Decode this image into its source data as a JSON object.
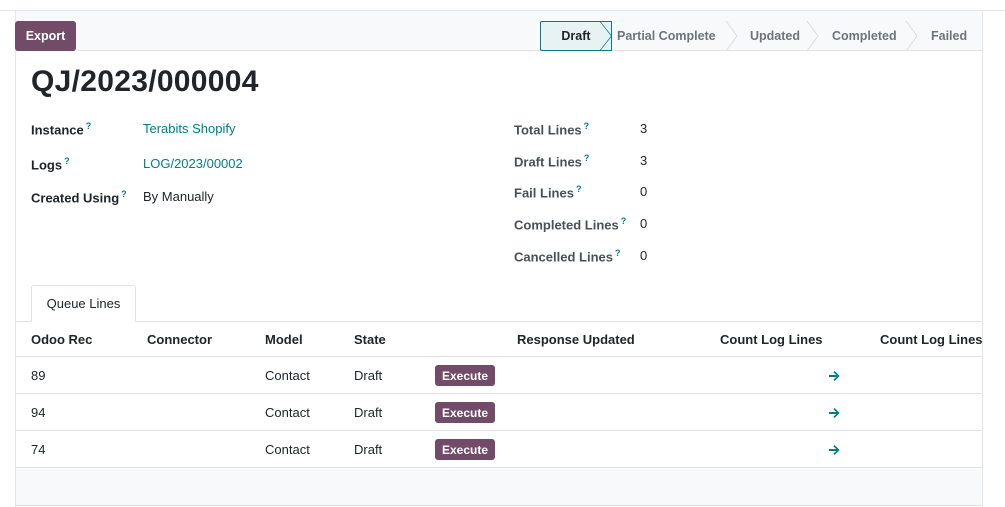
{
  "toolbar": {
    "export_label": "Export"
  },
  "stages": [
    {
      "label": "Draft",
      "active": true
    },
    {
      "label": "Partial Complete",
      "active": false
    },
    {
      "label": "Updated",
      "active": false
    },
    {
      "label": "Completed",
      "active": false
    },
    {
      "label": "Failed",
      "active": false
    }
  ],
  "record": {
    "title": "QJ/2023/000004"
  },
  "left_fields": [
    {
      "label": "Instance",
      "help": "?",
      "value": "Terabits Shopify",
      "link": true
    },
    {
      "label": "Logs",
      "help": "?",
      "value": "LOG/2023/00002",
      "link": true
    },
    {
      "label": "Created Using",
      "help": "?",
      "value": "By Manually",
      "link": false
    }
  ],
  "right_fields": [
    {
      "label": "Total Lines",
      "help": "?",
      "value": "3"
    },
    {
      "label": "Draft Lines",
      "help": "?",
      "value": "3"
    },
    {
      "label": "Fail Lines",
      "help": "?",
      "value": "0"
    },
    {
      "label": "Completed Lines",
      "help": "?",
      "value": "0"
    },
    {
      "label": "Cancelled Lines",
      "help": "?",
      "value": "0"
    }
  ],
  "tabs": [
    {
      "label": "Queue Lines"
    }
  ],
  "table": {
    "columns": [
      "Odoo Rec",
      "Connector",
      "Model",
      "State",
      "Response Updated",
      "Count Log Lines",
      "Count Log Lines"
    ],
    "execute_label": "Execute",
    "rows": [
      {
        "odoo_rec": "89",
        "connector": "",
        "model": "Contact",
        "state": "Draft"
      },
      {
        "odoo_rec": "94",
        "connector": "",
        "model": "Contact",
        "state": "Draft"
      },
      {
        "odoo_rec": "74",
        "connector": "",
        "model": "Contact",
        "state": "Draft"
      }
    ]
  },
  "colors": {
    "primary": "#714b67",
    "accent": "#017e84"
  },
  "icons": {
    "row_action": "arrow-right-icon"
  }
}
